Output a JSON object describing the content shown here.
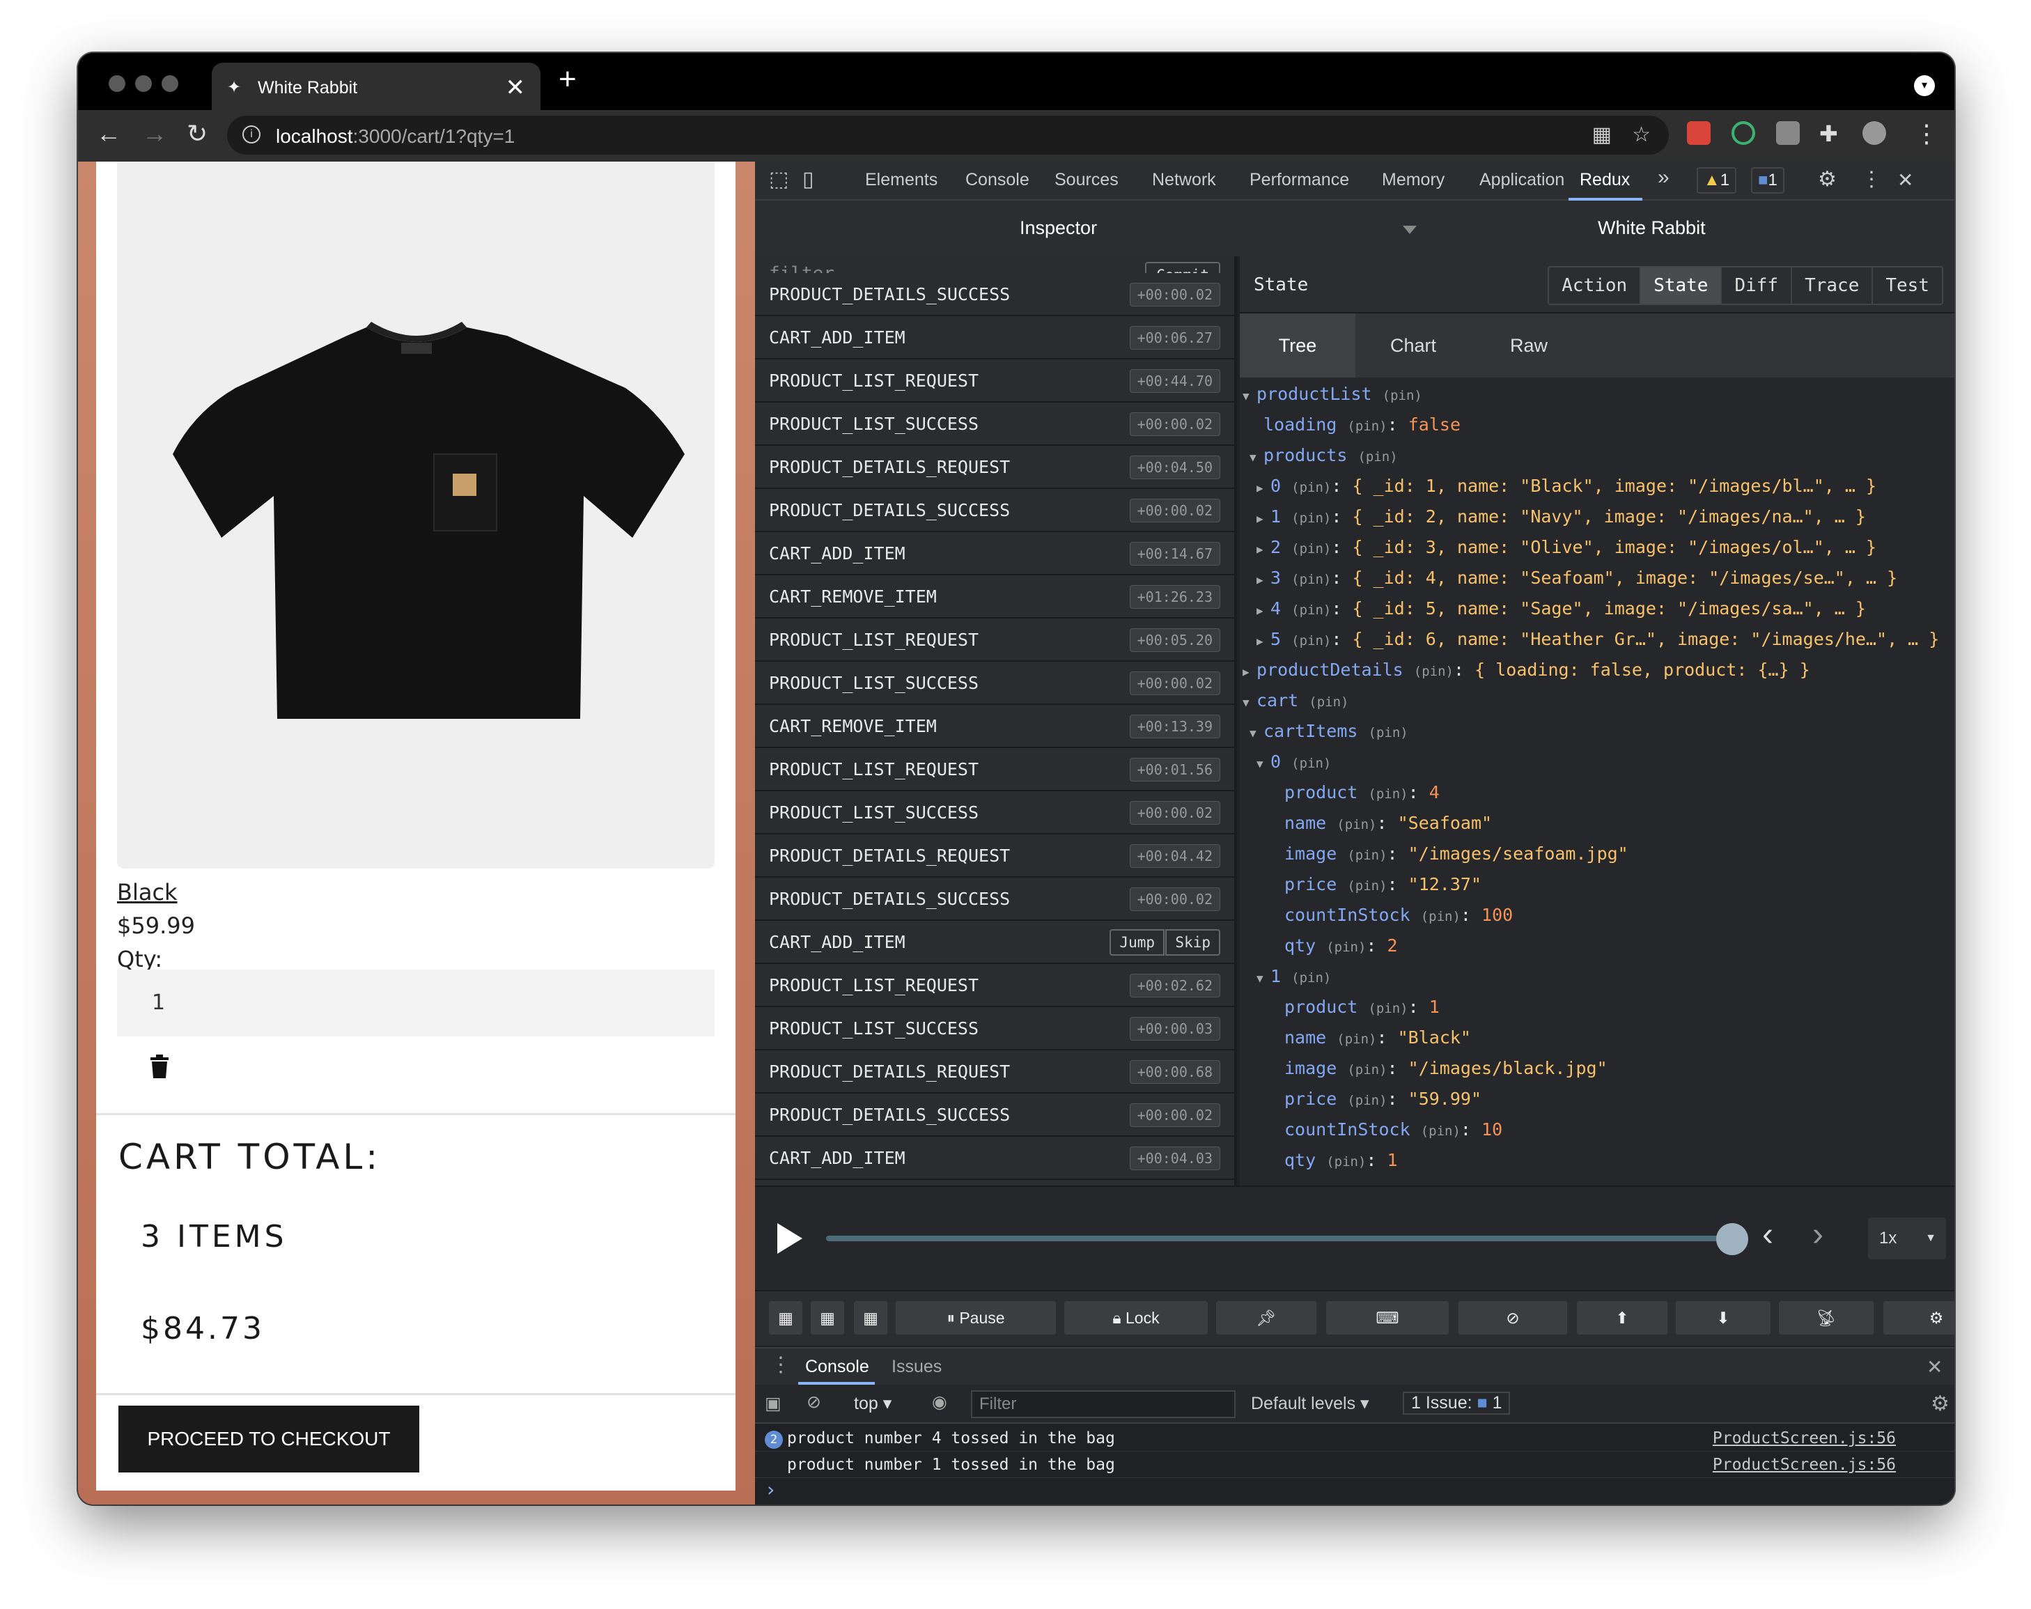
{
  "browser": {
    "tab_title": "White Rabbit",
    "tab_close": "✕",
    "new_tab": "+",
    "url_host": "localhost",
    "url_path": ":3000/cart/1?qty=1"
  },
  "product": {
    "name": "Black",
    "price": "$59.99",
    "qty_label": "Qty:",
    "qty_value": "1"
  },
  "cart_summary": {
    "title": "CART TOTAL:",
    "items": "3 ITEMS",
    "total": "$84.73",
    "checkout_label": "PROCEED TO CHECKOUT"
  },
  "devtools": {
    "tabs": [
      "Elements",
      "Console",
      "Sources",
      "Network",
      "Performance",
      "Memory",
      "Application",
      "Redux"
    ],
    "more": "»",
    "warnings": "1",
    "messages": "1",
    "close": "✕"
  },
  "redux": {
    "inspector_label": "Inspector",
    "instance_title": "White Rabbit",
    "filter_placeholder": "filter...",
    "commit_label": "Commit",
    "jump_label": "Jump",
    "skip_label": "Skip",
    "actions": [
      {
        "name": "PRODUCT_DETAILS_SUCCESS",
        "time": "+00:00.02"
      },
      {
        "name": "CART_ADD_ITEM",
        "time": "+00:06.27"
      },
      {
        "name": "PRODUCT_LIST_REQUEST",
        "time": "+00:44.70"
      },
      {
        "name": "PRODUCT_LIST_SUCCESS",
        "time": "+00:00.02"
      },
      {
        "name": "PRODUCT_DETAILS_REQUEST",
        "time": "+00:04.50"
      },
      {
        "name": "PRODUCT_DETAILS_SUCCESS",
        "time": "+00:00.02"
      },
      {
        "name": "CART_ADD_ITEM",
        "time": "+00:14.67"
      },
      {
        "name": "CART_REMOVE_ITEM",
        "time": "+01:26.23"
      },
      {
        "name": "PRODUCT_LIST_REQUEST",
        "time": "+00:05.20"
      },
      {
        "name": "PRODUCT_LIST_SUCCESS",
        "time": "+00:00.02"
      },
      {
        "name": "CART_REMOVE_ITEM",
        "time": "+00:13.39"
      },
      {
        "name": "PRODUCT_LIST_REQUEST",
        "time": "+00:01.56"
      },
      {
        "name": "PRODUCT_LIST_SUCCESS",
        "time": "+00:00.02"
      },
      {
        "name": "PRODUCT_DETAILS_REQUEST",
        "time": "+00:04.42"
      },
      {
        "name": "PRODUCT_DETAILS_SUCCESS",
        "time": "+00:00.02"
      },
      {
        "name": "CART_ADD_ITEM",
        "time": ""
      },
      {
        "name": "PRODUCT_LIST_REQUEST",
        "time": "+00:02.62"
      },
      {
        "name": "PRODUCT_LIST_SUCCESS",
        "time": "+00:00.03"
      },
      {
        "name": "PRODUCT_DETAILS_REQUEST",
        "time": "+00:00.68"
      },
      {
        "name": "PRODUCT_DETAILS_SUCCESS",
        "time": "+00:00.02"
      },
      {
        "name": "CART_ADD_ITEM",
        "time": "+00:04.03"
      }
    ],
    "state_label": "State",
    "modes": [
      "Action",
      "State",
      "Diff",
      "Trace",
      "Test"
    ],
    "selected_mode": "State",
    "subtabs": [
      "Tree",
      "Chart",
      "Raw"
    ],
    "selected_subtab": "Tree",
    "speed": "1x"
  },
  "state_tree": [
    {
      "i": 0,
      "tri": "▼",
      "key": "productList",
      "pin": "(pin)",
      "sep": "",
      "val": "",
      "vc": ""
    },
    {
      "i": 1,
      "tri": "",
      "key": "loading",
      "pin": "(pin)",
      "sep": ":",
      "val": "false",
      "vc": "b"
    },
    {
      "i": 1,
      "tri": "▼",
      "key": "products",
      "pin": "(pin)",
      "sep": "",
      "val": "",
      "vc": ""
    },
    {
      "i": 2,
      "tri": "▶",
      "key": "0",
      "pin": "(pin)",
      "sep": ":",
      "val": "{ _id: 1, name: \"Black\", image: \"/images/bl…\", … }",
      "vc": "obj"
    },
    {
      "i": 2,
      "tri": "▶",
      "key": "1",
      "pin": "(pin)",
      "sep": ":",
      "val": "{ _id: 2, name: \"Navy\", image: \"/images/na…\", … }",
      "vc": "obj"
    },
    {
      "i": 2,
      "tri": "▶",
      "key": "2",
      "pin": "(pin)",
      "sep": ":",
      "val": "{ _id: 3, name: \"Olive\", image: \"/images/ol…\", … }",
      "vc": "obj"
    },
    {
      "i": 2,
      "tri": "▶",
      "key": "3",
      "pin": "(pin)",
      "sep": ":",
      "val": "{ _id: 4, name: \"Seafoam\", image: \"/images/se…\", … }",
      "vc": "obj"
    },
    {
      "i": 2,
      "tri": "▶",
      "key": "4",
      "pin": "(pin)",
      "sep": ":",
      "val": "{ _id: 5, name: \"Sage\", image: \"/images/sa…\", … }",
      "vc": "obj"
    },
    {
      "i": 2,
      "tri": "▶",
      "key": "5",
      "pin": "(pin)",
      "sep": ":",
      "val": "{ _id: 6, name: \"Heather Gr…\", image: \"/images/he…\", … }",
      "vc": "obj"
    },
    {
      "i": 0,
      "tri": "▶",
      "key": "productDetails",
      "pin": "(pin)",
      "sep": ":",
      "val": "{ loading: false, product: {…} }",
      "vc": "obj"
    },
    {
      "i": 0,
      "tri": "▼",
      "key": "cart",
      "pin": "(pin)",
      "sep": "",
      "val": "",
      "vc": ""
    },
    {
      "i": 1,
      "tri": "▼",
      "key": "cartItems",
      "pin": "(pin)",
      "sep": "",
      "val": "",
      "vc": ""
    },
    {
      "i": 2,
      "tri": "▼",
      "key": "0",
      "pin": "(pin)",
      "sep": "",
      "val": "",
      "vc": ""
    },
    {
      "i": 4,
      "tri": "",
      "key": "product",
      "pin": "(pin)",
      "sep": ":",
      "val": "4",
      "vc": "n"
    },
    {
      "i": 4,
      "tri": "",
      "key": "name",
      "pin": "(pin)",
      "sep": ":",
      "val": "\"Seafoam\"",
      "vc": "s"
    },
    {
      "i": 4,
      "tri": "",
      "key": "image",
      "pin": "(pin)",
      "sep": ":",
      "val": "\"/images/seafoam.jpg\"",
      "vc": "s"
    },
    {
      "i": 4,
      "tri": "",
      "key": "price",
      "pin": "(pin)",
      "sep": ":",
      "val": "\"12.37\"",
      "vc": "s"
    },
    {
      "i": 4,
      "tri": "",
      "key": "countInStock",
      "pin": "(pin)",
      "sep": ":",
      "val": "100",
      "vc": "n"
    },
    {
      "i": 4,
      "tri": "",
      "key": "qty",
      "pin": "(pin)",
      "sep": ":",
      "val": "2",
      "vc": "n"
    },
    {
      "i": 2,
      "tri": "▼",
      "key": "1",
      "pin": "(pin)",
      "sep": "",
      "val": "",
      "vc": ""
    },
    {
      "i": 4,
      "tri": "",
      "key": "product",
      "pin": "(pin)",
      "sep": ":",
      "val": "1",
      "vc": "n"
    },
    {
      "i": 4,
      "tri": "",
      "key": "name",
      "pin": "(pin)",
      "sep": ":",
      "val": "\"Black\"",
      "vc": "s"
    },
    {
      "i": 4,
      "tri": "",
      "key": "image",
      "pin": "(pin)",
      "sep": ":",
      "val": "\"/images/black.jpg\"",
      "vc": "s"
    },
    {
      "i": 4,
      "tri": "",
      "key": "price",
      "pin": "(pin)",
      "sep": ":",
      "val": "\"59.99\"",
      "vc": "s"
    },
    {
      "i": 4,
      "tri": "",
      "key": "countInStock",
      "pin": "(pin)",
      "sep": ":",
      "val": "10",
      "vc": "n"
    },
    {
      "i": 4,
      "tri": "",
      "key": "qty",
      "pin": "(pin)",
      "sep": ":",
      "val": "1",
      "vc": "n"
    }
  ],
  "monitor_buttons": {
    "pause": "Pause",
    "lock": "Lock"
  },
  "console": {
    "tabs": [
      "Console",
      "Issues"
    ],
    "context": "top",
    "filter_placeholder": "Filter",
    "levels": "Default levels",
    "issues_label": "1 Issue:",
    "issues_count": "1",
    "repeat_count": "2",
    "logs": [
      {
        "msg": "product number 4 tossed in the bag",
        "src": "ProductScreen.js:56"
      },
      {
        "msg": "product number 1 tossed in the bag",
        "src": "ProductScreen.js:56"
      }
    ],
    "prompt": "›"
  },
  "colors": {
    "key": "#83a8f2",
    "string": "#f7c06b",
    "number": "#f59256",
    "accent": "#8ab4f8"
  }
}
